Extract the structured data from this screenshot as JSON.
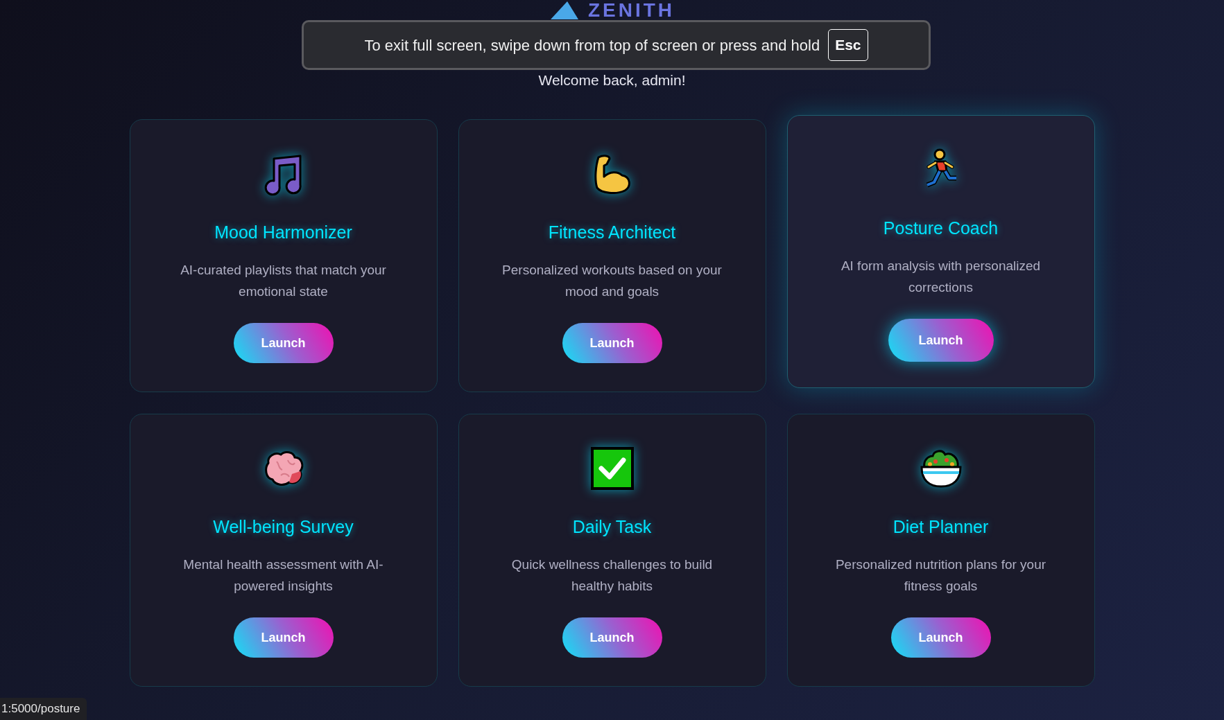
{
  "logo": {
    "text": "ZENITH"
  },
  "welcome": "Welcome back, admin!",
  "cards": [
    {
      "kind": "music",
      "title": "Mood Harmonizer",
      "description": "AI-curated playlists that match your emotional state",
      "button": "Launch",
      "hovered": false
    },
    {
      "kind": "muscle",
      "title": "Fitness Architect",
      "description": "Personalized workouts based on your mood and goals",
      "button": "Launch",
      "hovered": false
    },
    {
      "kind": "runner",
      "title": "Posture Coach",
      "description": "AI form analysis with personalized corrections",
      "button": "Launch",
      "hovered": true
    },
    {
      "kind": "brain",
      "title": "Well-being Survey",
      "description": "Mental health assessment with AI-powered insights",
      "button": "Launch",
      "hovered": false
    },
    {
      "kind": "check",
      "title": "Daily Task",
      "description": "Quick wellness challenges to build healthy habits",
      "button": "Launch",
      "hovered": false
    },
    {
      "kind": "salad",
      "title": "Diet Planner",
      "description": "Personalized nutrition plans for your fitness goals",
      "button": "Launch",
      "hovered": false
    }
  ],
  "fullscreen_toast": {
    "message": "To exit full screen, swipe down from top of screen or press and hold",
    "key": "Esc"
  },
  "status_url": "1:5000/posture"
}
